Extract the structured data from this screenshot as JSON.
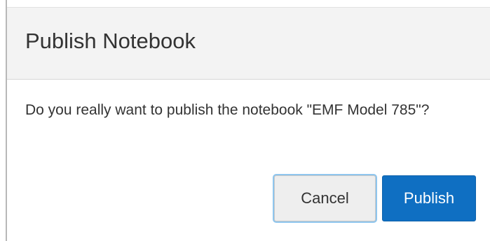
{
  "dialog": {
    "title": "Publish Notebook",
    "message": "Do you really want to publish the notebook \"EMF Model 785\"?",
    "cancel_label": "Cancel",
    "publish_label": "Publish"
  },
  "colors": {
    "header_bg": "#f3f3f3",
    "primary_button": "#0f6fc2",
    "secondary_button": "#eeeeee",
    "focus_ring": "#8fc6ee",
    "text": "#333333"
  }
}
